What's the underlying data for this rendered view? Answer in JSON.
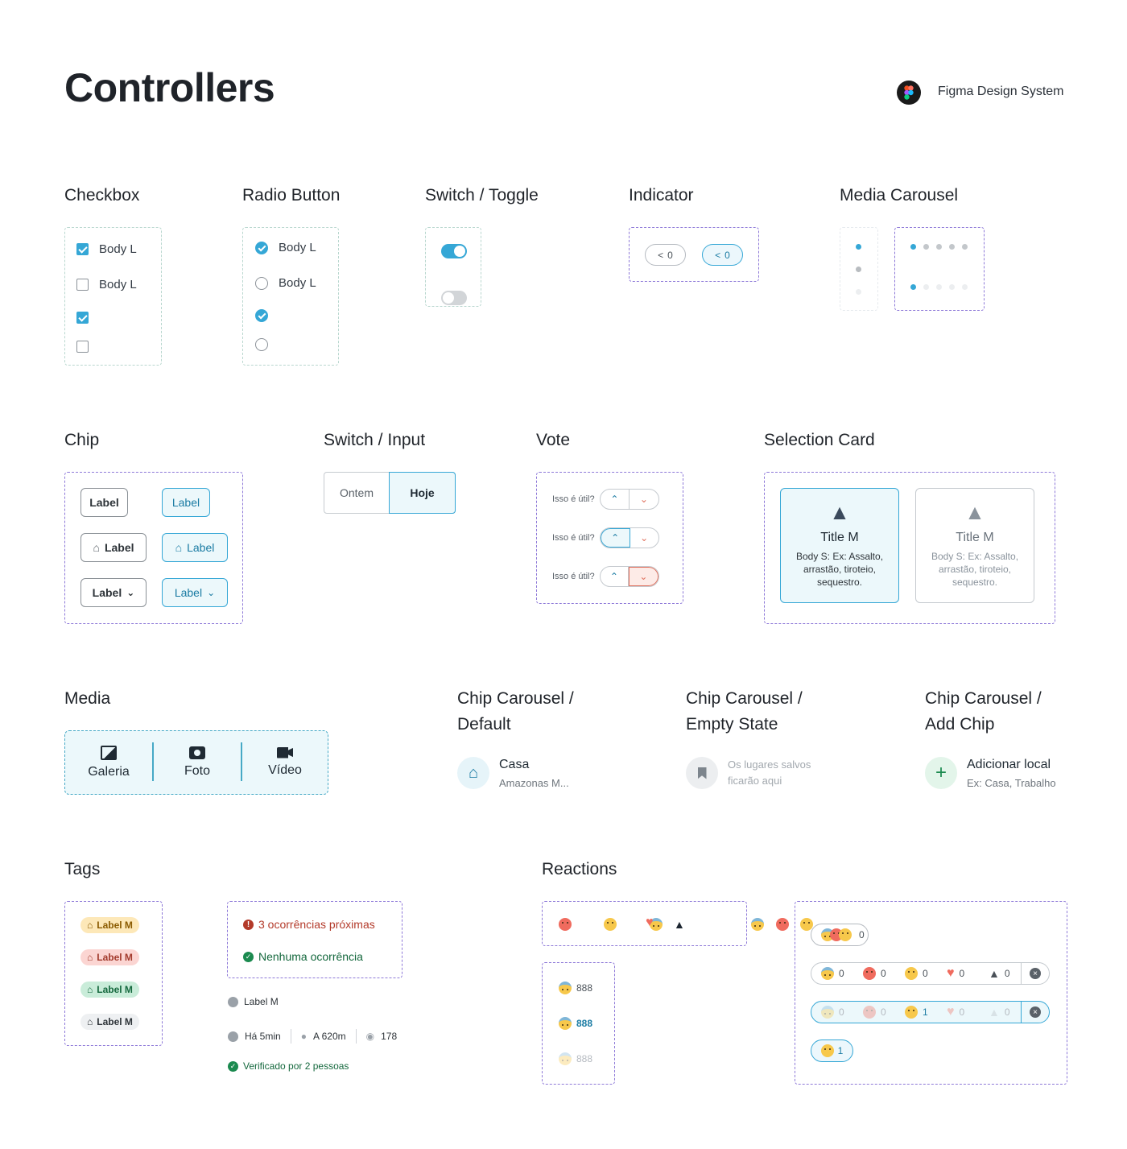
{
  "header": {
    "title": "Controllers",
    "brand": "Figma Design System"
  },
  "sections": {
    "checkbox": "Checkbox",
    "radio": "Radio Button",
    "switch_toggle": "Switch / Toggle",
    "indicator": "Indicator",
    "media_carousel": "Media Carousel",
    "chip": "Chip",
    "switch_input": "Switch / Input",
    "vote": "Vote",
    "selection_card": "Selection Card",
    "media": "Media",
    "chip_carousel_default": [
      "Chip Carousel /",
      "Default"
    ],
    "chip_carousel_empty": [
      "Chip Carousel /",
      "Empty State"
    ],
    "chip_carousel_add": [
      "Chip Carousel /",
      "Add Chip"
    ],
    "tags": "Tags",
    "reactions": "Reactions"
  },
  "checkbox": {
    "labels": [
      "Body L",
      "Body L"
    ],
    "states": [
      true,
      false,
      true,
      false
    ]
  },
  "radio": {
    "labels": [
      "Body L",
      "Body L"
    ],
    "states": [
      true,
      false,
      true,
      false
    ]
  },
  "toggle": {
    "states": [
      true,
      false
    ],
    "accent": "#35a7d6",
    "off": "#d2d5d8"
  },
  "indicator": {
    "counts": [
      "0",
      "0"
    ],
    "active": [
      false,
      true
    ]
  },
  "chip": {
    "labels": [
      "Label",
      "Label",
      "Label",
      "Label",
      "Label",
      "Label"
    ]
  },
  "switch_input": {
    "options": [
      "Ontem",
      "Hoje"
    ],
    "selected": "Hoje"
  },
  "vote": {
    "question": "Isso é útil?",
    "states": [
      "none",
      "up",
      "down"
    ]
  },
  "selection_card": {
    "cards": [
      {
        "title": "Title M",
        "body": "Body S: Ex: Assalto, arrastão, tiroteio, sequestro.",
        "selected": true
      },
      {
        "title": "Title M",
        "body": "Body S: Ex: Assalto, arrastão, tiroteio, sequestro.",
        "selected": false
      }
    ]
  },
  "media": {
    "options": [
      "Galeria",
      "Foto",
      "Vídeo"
    ]
  },
  "chip_carousel": {
    "default": {
      "title": "Casa",
      "subtitle": "Amazonas M..."
    },
    "empty": {
      "text": "Os lugares salvos ficarão aqui"
    },
    "add": {
      "title": "Adicionar local",
      "subtitle": "Ex: Casa, Trabalho"
    }
  },
  "tags": {
    "labels": [
      "Label M",
      "Label M",
      "Label M",
      "Label M"
    ],
    "colors": [
      "#fde8b8",
      "#fbd5d2",
      "#c9ecd9",
      "#eef0f2"
    ],
    "alert_error": "3 ocorrências próximas",
    "alert_ok": "Nenhuma ocorrência",
    "meta_label": "Label M",
    "meta_time": "Há 5min",
    "meta_distance": "A 620m",
    "meta_views": "178",
    "verified": "Verificado por 2 pessoas"
  },
  "reactions": {
    "counts_list": [
      "888",
      "888",
      "888"
    ],
    "summary_count": "0",
    "row1": [
      "0",
      "0",
      "0",
      "0",
      "0"
    ],
    "row2": [
      "0",
      "0",
      "1",
      "0",
      "0"
    ],
    "single_count": "1"
  }
}
